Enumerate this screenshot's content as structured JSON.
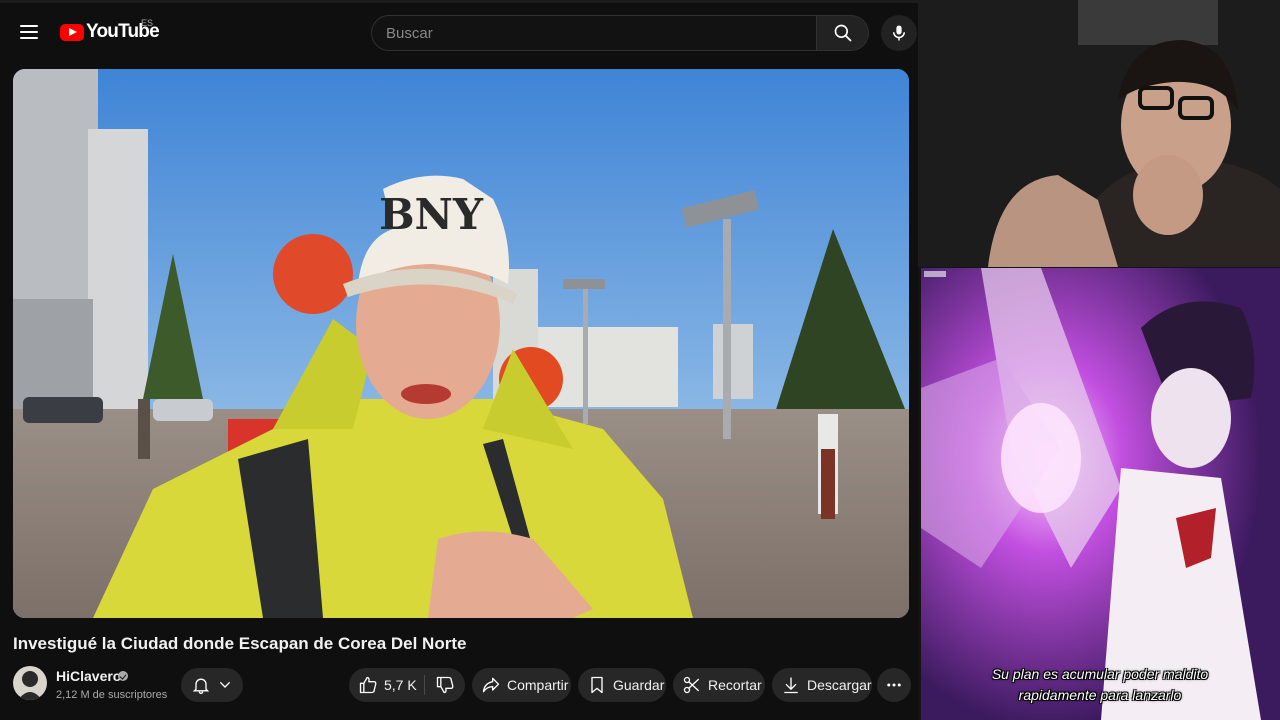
{
  "header": {
    "logo_text": "YouTube",
    "region_code": "ES",
    "search_placeholder": "Buscar"
  },
  "video": {
    "title": "Investigué la Ciudad donde Escapan de Corea Del Norte",
    "cap_text": "BNY"
  },
  "channel": {
    "name": "HiClavero",
    "subscribers": "2,12 M de suscriptores"
  },
  "actions": {
    "like_count": "5,7 K",
    "share_label": "Compartir",
    "save_label": "Guardar",
    "clip_label": "Recortar",
    "download_label": "Descargar"
  },
  "overlay": {
    "subtitle_line1": "Su plan es acumular poder maldito",
    "subtitle_line2": "rapidamente para lanzarlo"
  },
  "colors": {
    "background": "#0f0f0f",
    "pill": "#272727",
    "brand_red": "#ff0000",
    "anime_purple": "#a24bd6"
  }
}
